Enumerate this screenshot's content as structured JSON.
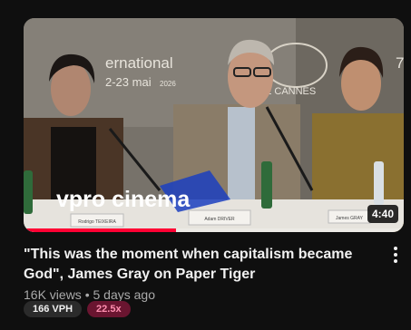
{
  "video": {
    "title": "\"This was the moment when capitalism became God\", James Gray on Paper Tiger",
    "duration": "4:40",
    "views": "16K views",
    "separator": "•",
    "age": "5 days ago",
    "progress_fraction": 0.4
  },
  "thumbnail": {
    "backdrop_text_line1": "ernational",
    "backdrop_text_line2": "2-23 mai",
    "backdrop_year": "2026",
    "backdrop_cannes": "E CANNES",
    "backdrop_edge": "7",
    "overlay_brand": "vpro cinema",
    "nameplate_left": "Rodrigo TEIXEIRA",
    "nameplate_center": "Adam DRIVER",
    "nameplate_right": "James GRAY"
  },
  "badges": {
    "vph": "166 VPH",
    "multiplier": "22.5x"
  },
  "colors": {
    "background": "#0f0f0f",
    "title": "#f1f1f1",
    "meta": "#aaaaaa",
    "progress": "#ff0033",
    "vph_badge": "#2b2b2b",
    "multiplier_badge": "#6a1530",
    "multiplier_text": "#ff8fb0"
  },
  "icons": {
    "menu": "more-vert-icon"
  }
}
